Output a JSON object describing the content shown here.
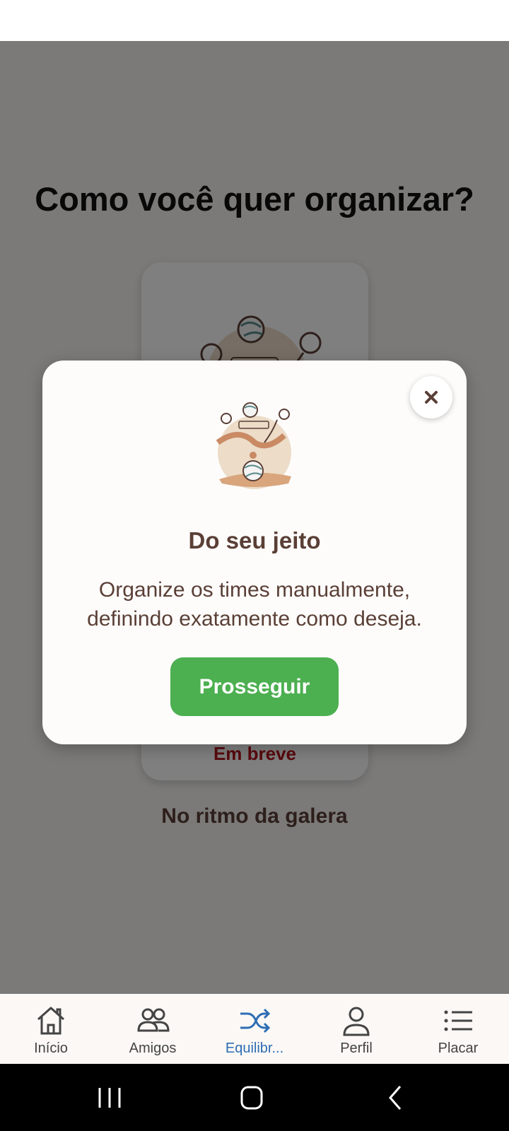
{
  "page": {
    "title": "Como você quer organizar?"
  },
  "option_card": {
    "status": "Em breve",
    "title": "No ritmo da galera"
  },
  "modal": {
    "title": "Do seu jeito",
    "description": "Organize os times manualmente, definindo exatamente como deseja.",
    "primary_button": "Prosseguir",
    "close_icon": "close-icon"
  },
  "tabbar": {
    "active_color": "#2e6db4",
    "items": [
      {
        "label": "Início",
        "icon": "home-icon"
      },
      {
        "label": "Amigos",
        "icon": "friends-icon"
      },
      {
        "label": "Equilibr...",
        "icon": "shuffle-icon",
        "active": true
      },
      {
        "label": "Perfil",
        "icon": "profile-icon"
      },
      {
        "label": "Placar",
        "icon": "list-icon"
      }
    ]
  },
  "system_nav": {
    "buttons": [
      "recent-apps-icon",
      "home-button-icon",
      "back-icon"
    ]
  },
  "colors": {
    "accent": "#4caf50",
    "title_brown": "#5a3f36",
    "soon_red": "#b3121b"
  }
}
